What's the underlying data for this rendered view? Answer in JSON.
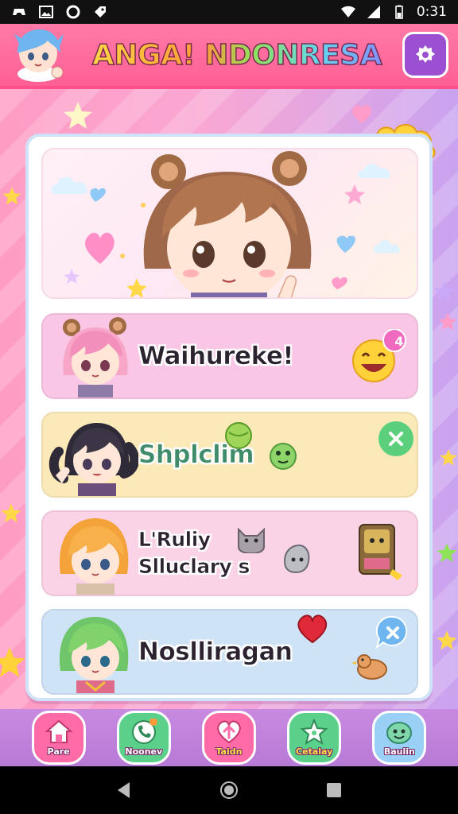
{
  "status_bar": {
    "time": "0:31",
    "icons_left": [
      "game-icon",
      "image-icon",
      "circle-icon",
      "tag-icon"
    ],
    "icons_right": [
      "wifi-icon",
      "signal-icon",
      "battery-icon"
    ]
  },
  "header": {
    "title": "ANGA! NDONRESA",
    "settings_icon": "settings-icon"
  },
  "menu": {
    "items": [
      {
        "label": "Waihureke!",
        "bg": "#f9c6e6",
        "badge": "4",
        "badge_color": "#f06bbf"
      },
      {
        "label": "Shplclim",
        "bg": "#fbe9b8",
        "badge_color": "#5ccf7d"
      },
      {
        "label_line1": "L'Ruliy",
        "label_line2": "Slluclary s",
        "bg": "#fbd3e6"
      },
      {
        "label": "Noslliragan",
        "bg": "#cfe3f7"
      }
    ]
  },
  "bottom_nav": {
    "items": [
      {
        "label": "Pare",
        "icon": "home-icon",
        "color": "#ff6ba7"
      },
      {
        "label": "Noonev",
        "icon": "phone-icon",
        "color": "#5ad08a"
      },
      {
        "label": "Taidn",
        "icon": "heart-arrow-icon",
        "color": "#ff6ba7"
      },
      {
        "label": "Cetalay",
        "icon": "star-icon",
        "color": "#5ad08a"
      },
      {
        "label": "Baulin",
        "icon": "smiley-icon",
        "color": "#9ad0f5"
      }
    ]
  },
  "colors": {
    "header_pink": "#ff6a9c",
    "panel_border": "#cfe2f7",
    "nav_purple": "#c08ade"
  }
}
